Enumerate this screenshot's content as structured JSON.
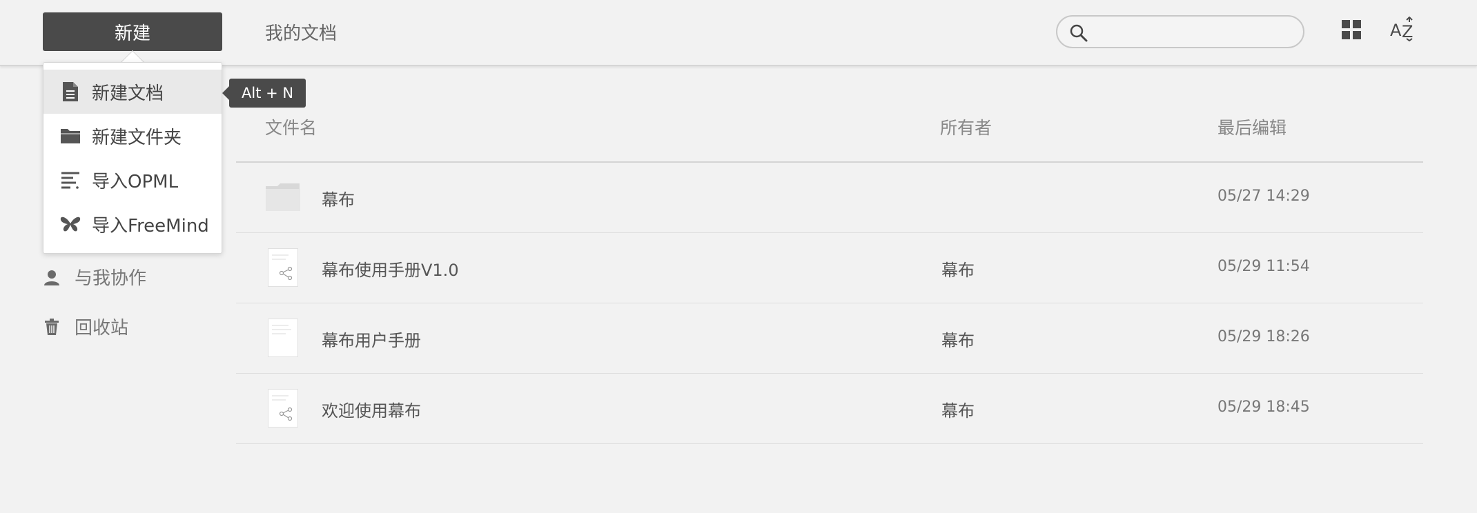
{
  "header": {
    "new_button": "新建",
    "my_docs": "我的文档",
    "search_placeholder": ""
  },
  "dropdown": {
    "items": [
      {
        "label": "新建文档",
        "icon": "document-icon"
      },
      {
        "label": "新建文件夹",
        "icon": "folder-icon"
      },
      {
        "label": "导入OPML",
        "icon": "opml-icon"
      },
      {
        "label": "导入FreeMind",
        "icon": "butterfly-icon"
      }
    ],
    "tooltip": "Alt + N"
  },
  "sidebar": {
    "items": [
      {
        "label": "与我协作",
        "icon": "user-icon"
      },
      {
        "label": "回收站",
        "icon": "trash-icon"
      }
    ]
  },
  "table": {
    "headers": {
      "name": "文件名",
      "owner": "所有者",
      "date": "最后编辑"
    },
    "rows": [
      {
        "name": "幕布",
        "owner": "",
        "date": "05/27 14:29",
        "type": "folder"
      },
      {
        "name": "幕布使用手册V1.0",
        "owner": "幕布",
        "date": "05/29 11:54",
        "type": "shared-doc"
      },
      {
        "name": "幕布用户手册",
        "owner": "幕布",
        "date": "05/29 18:26",
        "type": "doc"
      },
      {
        "name": "欢迎使用幕布",
        "owner": "幕布",
        "date": "05/29 18:45",
        "type": "shared-doc"
      }
    ]
  }
}
